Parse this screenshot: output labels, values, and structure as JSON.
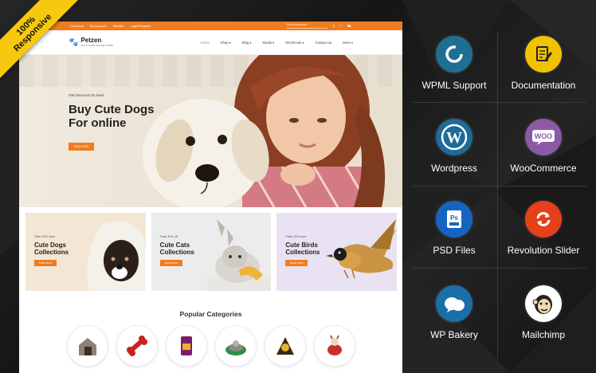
{
  "ribbon": {
    "line1": "100%",
    "line2": "Responsive"
  },
  "topbar": {
    "links": [
      "Checkout",
      "My Account",
      "Wishlist",
      "Login/Register"
    ],
    "search_placeholder": "Search products..."
  },
  "header": {
    "brand": "Petzen",
    "tagline": "PET'S SHOP ONLINE STORE",
    "menu": [
      "Home",
      "Shop",
      "Blog",
      "Media",
      "ShortCode",
      "Contact Us",
      "More"
    ]
  },
  "hero": {
    "kicker": "Flat Discount On Deal",
    "headline": "Buy Cute Dogs For online",
    "button": "DISCOVER"
  },
  "cards": [
    {
      "kicker": "Flate 20% save",
      "title": "Cute Dogs Collections",
      "button": "SHOP NOW",
      "bg": "#f3e6d4"
    },
    {
      "kicker": "Flate 30% off",
      "title": "Cute Cats Collections",
      "button": "SHOP NOW",
      "bg": "#ececec"
    },
    {
      "kicker": "Flate 15% save",
      "title": "Cute Birds Collections",
      "button": "SHOP NOW",
      "bg": "#e8e2f2"
    }
  ],
  "categories_title": "Popular Categories",
  "features": [
    {
      "label": "WPML Support",
      "color": "#1f6f95",
      "icon": "wpml-icon"
    },
    {
      "label": "Documentation",
      "color": "#f2c200",
      "icon": "documentation-icon"
    },
    {
      "label": "Wordpress",
      "color": "#1e6a98",
      "icon": "wordpress-icon"
    },
    {
      "label": "WooCommerce",
      "color": "#8b5aa6",
      "icon": "woocommerce-icon"
    },
    {
      "label": "PSD Files",
      "color": "#1565c0",
      "icon": "psd-icon"
    },
    {
      "label": "Revolution Slider",
      "color": "#e6401a",
      "icon": "revolution-slider-icon"
    },
    {
      "label": "WP Bakery",
      "color": "#1a6fa8",
      "icon": "wpbakery-icon"
    },
    {
      "label": "Mailchimp",
      "color": "#ffffff",
      "icon": "mailchimp-icon"
    }
  ],
  "accent": "#ef7d20"
}
